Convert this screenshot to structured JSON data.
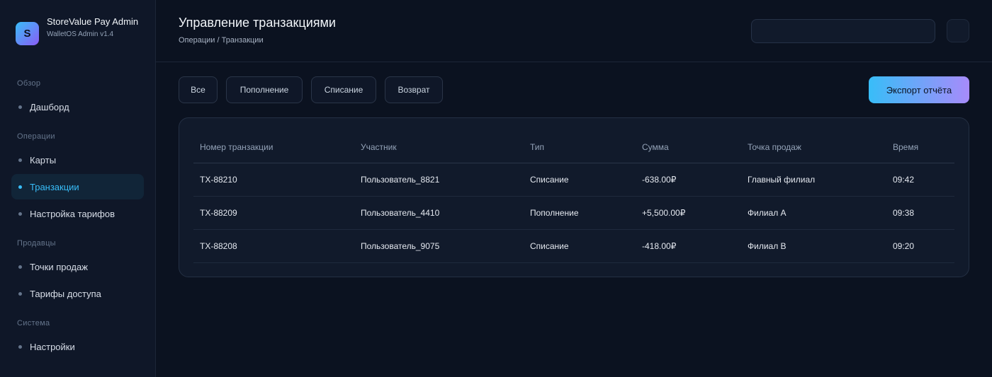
{
  "brand": {
    "logo_letter": "S",
    "title": "StoreValue Pay Admin",
    "subtitle": "WalletOS Admin v1.4"
  },
  "sidebar": {
    "groups": [
      {
        "label": "Обзор",
        "items": [
          {
            "label": "Дашборд",
            "active": false
          }
        ]
      },
      {
        "label": "Операции",
        "items": [
          {
            "label": "Карты",
            "active": false
          },
          {
            "label": "Транзакции",
            "active": true
          },
          {
            "label": "Настройка тарифов",
            "active": false
          }
        ]
      },
      {
        "label": "Продавцы",
        "items": [
          {
            "label": "Точки продаж",
            "active": false
          },
          {
            "label": "Тарифы доступа",
            "active": false
          }
        ]
      },
      {
        "label": "Система",
        "items": [
          {
            "label": "Настройки",
            "active": false
          }
        ]
      }
    ]
  },
  "header": {
    "title": "Управление транзакциями",
    "breadcrumb": "Операции / Транзакции",
    "search_value": ""
  },
  "filters": [
    "Все",
    "Пополнение",
    "Списание",
    "Возврат"
  ],
  "export_label": "Экспорт отчёта",
  "table": {
    "columns": [
      "Номер транзакции",
      "Участник",
      "Тип",
      "Сумма",
      "Точка продаж",
      "Время"
    ],
    "rows": [
      [
        "TX-88210",
        "Пользователь_8821",
        "Списание",
        "-638.00₽",
        "Главный филиал",
        "09:42"
      ],
      [
        "TX-88209",
        "Пользователь_4410",
        "Пополнение",
        "+5,500.00₽",
        "Филиал A",
        "09:38"
      ],
      [
        "TX-88208",
        "Пользователь_9075",
        "Списание",
        "-418.00₽",
        "Филиал B",
        "09:20"
      ]
    ]
  },
  "colors": {
    "background": "#0b1220",
    "accent": "#38bdf8",
    "accent_end": "#a78bfa"
  }
}
